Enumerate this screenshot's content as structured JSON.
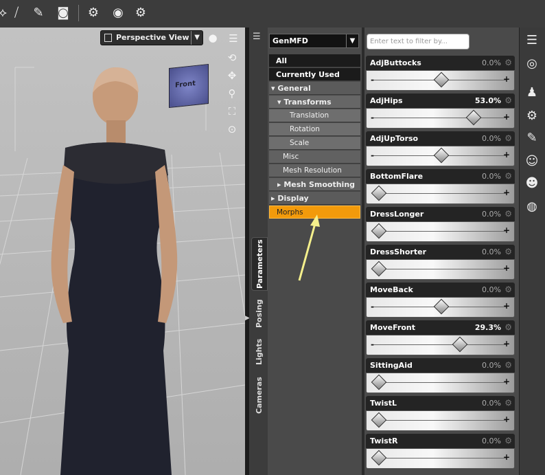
{
  "toolbar": {
    "icons": [
      "node-icon",
      "joint-icon",
      "edit-icon",
      "camera-render-icon",
      "settings-icon",
      "camera-icon",
      "render-settings-icon"
    ]
  },
  "viewport": {
    "view_name": "Perspective View",
    "cube_label": "Front"
  },
  "side_tabs": [
    {
      "label": "Parameters",
      "active": true
    },
    {
      "label": "Posing",
      "active": false
    },
    {
      "label": "Lights",
      "active": false
    },
    {
      "label": "Cameras",
      "active": false
    }
  ],
  "tree": {
    "selected_node": "GenMFD",
    "items": [
      {
        "label": "All"
      },
      {
        "label": "Currently Used"
      },
      {
        "label": "▾ General"
      },
      {
        "label": "▾ Transforms"
      },
      {
        "label": "Translation"
      },
      {
        "label": "Rotation"
      },
      {
        "label": "Scale"
      },
      {
        "label": "Misc"
      },
      {
        "label": "Mesh Resolution"
      },
      {
        "label": "▸ Mesh Smoothing"
      },
      {
        "label": "▸ Display"
      },
      {
        "label": "Morphs"
      }
    ]
  },
  "filter": {
    "placeholder": "Enter text to filter by..."
  },
  "parameters": [
    {
      "name": "AdjButtocks",
      "value": "0.0%",
      "pos": 0.5,
      "minus": "-"
    },
    {
      "name": "AdjHips",
      "value": "53.0%",
      "pos": 0.765,
      "minus": "-"
    },
    {
      "name": "AdjUpTorso",
      "value": "0.0%",
      "pos": 0.5,
      "minus": "-"
    },
    {
      "name": "BottomFlare",
      "value": "0.0%",
      "pos": 0.0,
      "minus": ""
    },
    {
      "name": "DressLonger",
      "value": "0.0%",
      "pos": 0.0,
      "minus": ""
    },
    {
      "name": "DressShorter",
      "value": "0.0%",
      "pos": 0.0,
      "minus": ""
    },
    {
      "name": "MoveBack",
      "value": "0.0%",
      "pos": 0.5,
      "minus": "-"
    },
    {
      "name": "MoveFront",
      "value": "29.3%",
      "pos": 0.65,
      "minus": "-"
    },
    {
      "name": "SittingAid",
      "value": "0.0%",
      "pos": 0.0,
      "minus": ""
    },
    {
      "name": "TwistL",
      "value": "0.0%",
      "pos": 0.0,
      "minus": ""
    },
    {
      "name": "TwistR",
      "value": "0.0%",
      "pos": 0.0,
      "minus": ""
    }
  ],
  "slider_plus": "+",
  "right_toolbar": [
    "pane-menu-icon",
    "surfaces-icon",
    "pose-icon",
    "figure-setup-icon",
    "draw-icon",
    "character-icon",
    "character-alt-icon",
    "environment-icon"
  ],
  "colors": {
    "selected": "#f29a0b",
    "panel": "#4a4a4a",
    "highlight_arrow": "#f5f08c"
  }
}
